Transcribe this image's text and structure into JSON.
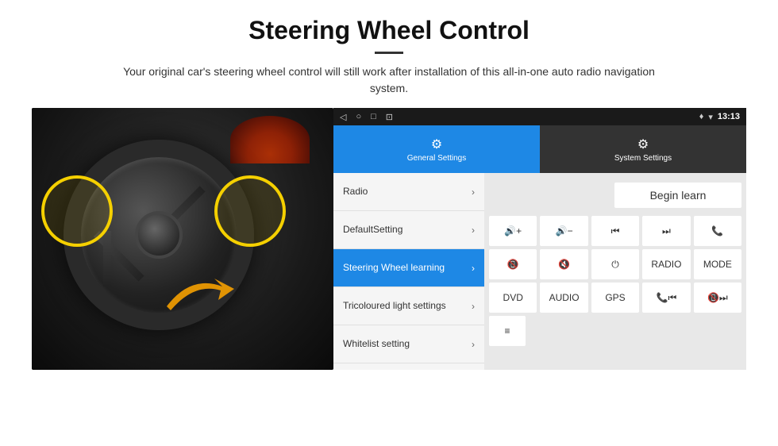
{
  "header": {
    "title": "Steering Wheel Control",
    "divider": true,
    "description": "Your original car's steering wheel control will still work after installation of this all-in-one auto radio navigation system."
  },
  "tablet": {
    "status_bar": {
      "nav_icons": [
        "◁",
        "○",
        "□",
        "⊡"
      ],
      "right_icons": [
        "♥",
        "▾"
      ],
      "time": "13:13"
    },
    "tabs": [
      {
        "id": "general",
        "label": "General Settings",
        "icon": "⚙",
        "active": true
      },
      {
        "id": "system",
        "label": "System Settings",
        "icon": "🔧",
        "active": false
      }
    ],
    "menu_items": [
      {
        "label": "Radio",
        "active": false
      },
      {
        "label": "DefaultSetting",
        "active": false
      },
      {
        "label": "Steering Wheel learning",
        "active": true
      },
      {
        "label": "Tricoloured light settings",
        "active": false
      },
      {
        "label": "Whitelist setting",
        "active": false
      }
    ],
    "begin_learn_label": "Begin learn",
    "button_rows": [
      [
        {
          "label": "🔊+",
          "type": "icon"
        },
        {
          "label": "🔊−",
          "type": "icon"
        },
        {
          "label": "⏮",
          "type": "icon"
        },
        {
          "label": "⏭",
          "type": "icon"
        },
        {
          "label": "📞",
          "type": "icon"
        }
      ],
      [
        {
          "label": "📵",
          "type": "icon"
        },
        {
          "label": "🔇",
          "type": "icon"
        },
        {
          "label": "⏻",
          "type": "icon"
        },
        {
          "label": "RADIO",
          "type": "text"
        },
        {
          "label": "MODE",
          "type": "text"
        }
      ],
      [
        {
          "label": "DVD",
          "type": "text"
        },
        {
          "label": "AUDIO",
          "type": "text"
        },
        {
          "label": "GPS",
          "type": "text"
        },
        {
          "label": "📞⏮",
          "type": "icon"
        },
        {
          "label": "📵⏭",
          "type": "icon"
        }
      ],
      [
        {
          "label": "≡",
          "type": "icon"
        }
      ]
    ]
  }
}
